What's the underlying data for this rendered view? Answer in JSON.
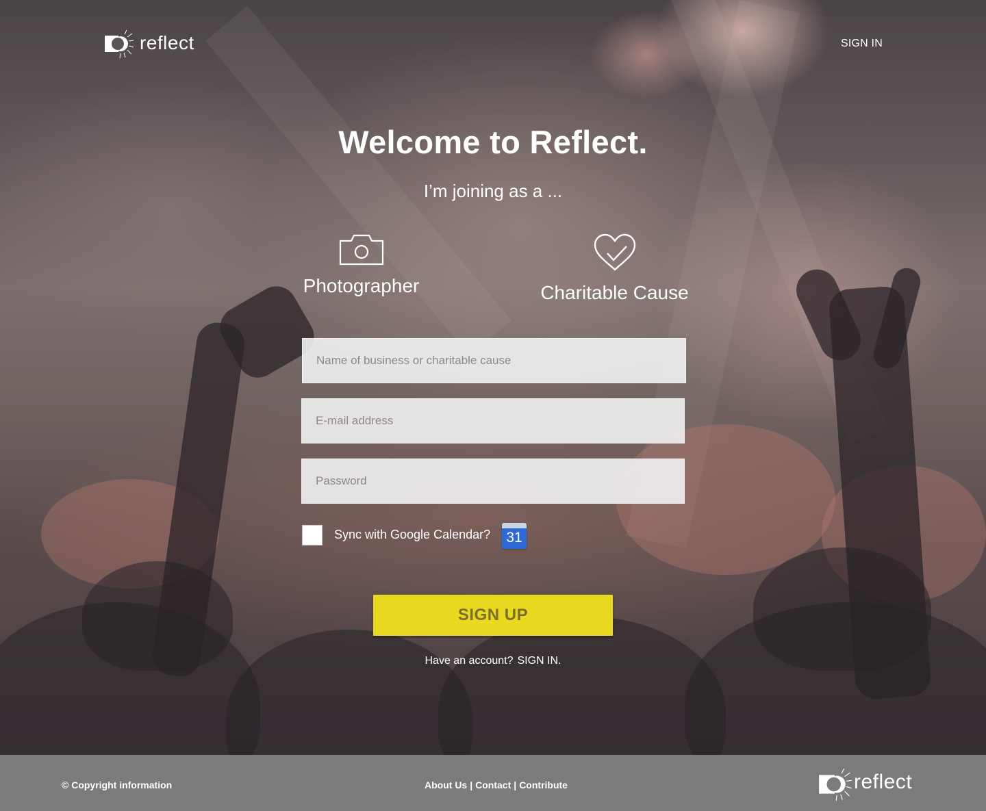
{
  "header": {
    "logo_text": "reflect",
    "signin_label": "SIGN IN"
  },
  "main": {
    "title": "Welcome to Reflect.",
    "subtitle": "I’m joining as a ...",
    "roles": [
      {
        "label": "Photographer",
        "icon": "camera-icon"
      },
      {
        "label": "Charitable Cause",
        "icon": "heart-icon"
      }
    ]
  },
  "form": {
    "name_placeholder": "Name of business or charitable cause",
    "email_placeholder": "E-mail address",
    "password_placeholder": "Password",
    "sync_label": "Sync with Google Calendar?",
    "calendar_day": "31",
    "signup_label": "SIGN UP",
    "have_account_text": "Have an account?",
    "signin_link": "SIGN IN."
  },
  "footer": {
    "copyright": "© Copyright information",
    "links": [
      "About Us",
      "Contact",
      "Contribute"
    ],
    "separator": "|",
    "logo_text": "reflect"
  },
  "colors": {
    "accent": "#e9d820",
    "footer_bg": "#7b7b7b",
    "calendar_blue": "#2e6ad6"
  }
}
